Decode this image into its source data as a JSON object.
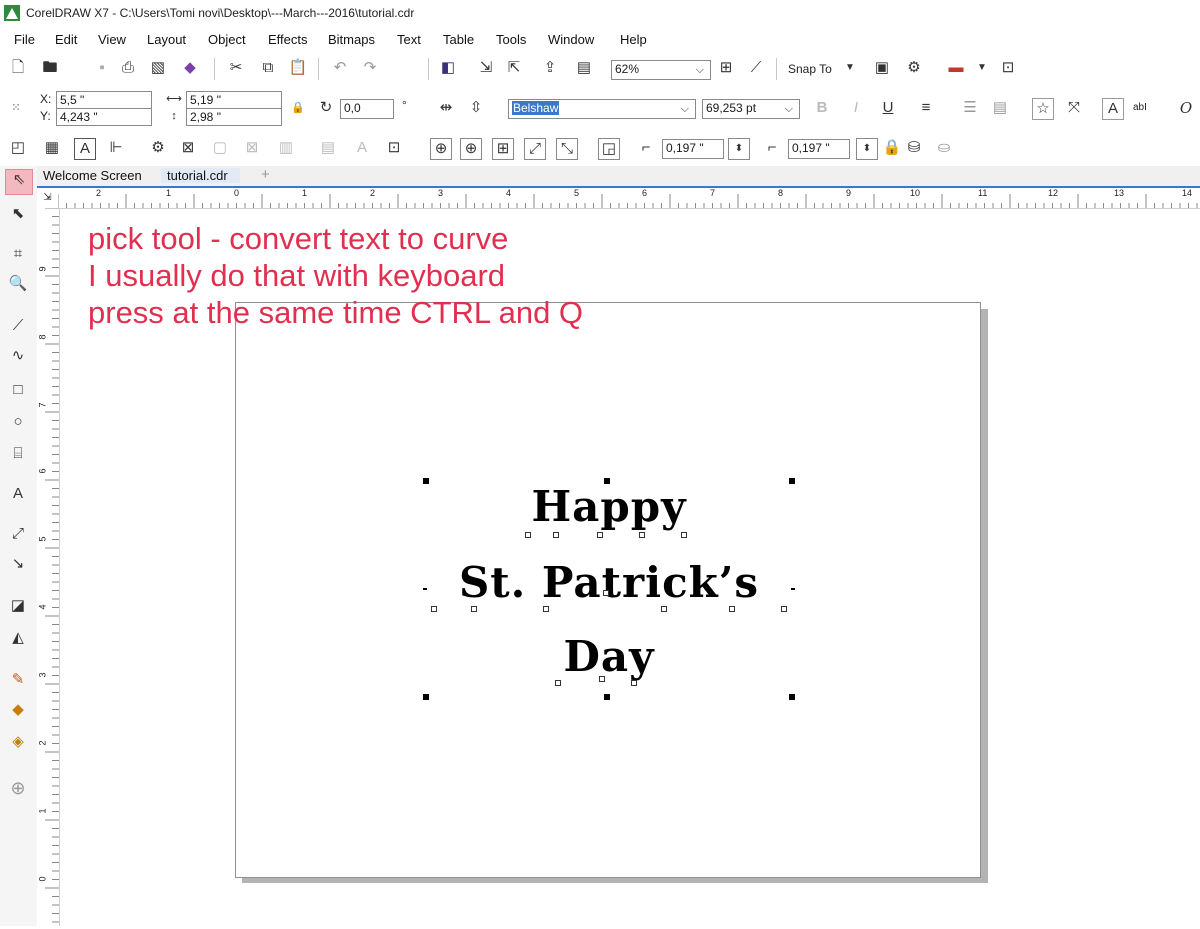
{
  "window": {
    "title": "CorelDRAW X7 - C:\\Users\\Tomi novi\\Desktop\\---March---2016\\tutorial.cdr"
  },
  "menu": [
    "File",
    "Edit",
    "View",
    "Layout",
    "Object",
    "Effects",
    "Bitmaps",
    "Text",
    "Table",
    "Tools",
    "Window",
    "Help"
  ],
  "standard_toolbar": {
    "zoom": "62%",
    "snap_to": "Snap To"
  },
  "property_bar": {
    "x_label": "X:",
    "x_value": "5,5 \"",
    "y_label": "Y:",
    "y_value": "4,243 \"",
    "width_value": "5,19 \"",
    "height_value": "2,98 \"",
    "rotation_value": "0,0",
    "degree_symbol": "°",
    "font_name": "Belshaw",
    "font_size": "69,253 pt",
    "text_tool_label": "abI"
  },
  "toolbar3": {
    "nudge_value": "0,197 \"",
    "duplicate_value": "0,197 \""
  },
  "tabs": [
    {
      "label": "Welcome Screen"
    },
    {
      "label": "tutorial.cdr"
    }
  ],
  "ruler": {
    "h_ticks": [
      "2",
      "1",
      "0",
      "1",
      "2",
      "3",
      "4",
      "5",
      "6",
      "7",
      "8",
      "9",
      "10",
      "11",
      "12",
      "13",
      "14"
    ],
    "v_ticks": [
      "9",
      "8",
      "7",
      "6",
      "5",
      "4",
      "3",
      "2",
      "1",
      "0"
    ]
  },
  "annotation": {
    "line1": "pick tool - convert text to curve",
    "line2": "I usually do that with keyboard",
    "line3": "press at the same time CTRL and Q"
  },
  "canvas_text": {
    "line1": "Happy",
    "line2": "St. Patrick’s",
    "line3": "Day"
  },
  "colors": {
    "annotation": "#e0304f",
    "tab_accent": "#3c78c8",
    "active_tool": "#f4b8c0"
  }
}
